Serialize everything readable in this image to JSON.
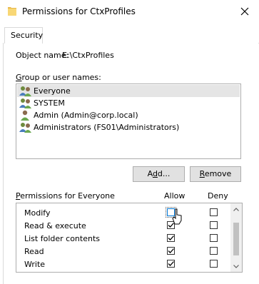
{
  "window": {
    "title": "Permissions for CtxProfiles",
    "close_glyph": "✕"
  },
  "tabs": [
    {
      "label": "Security",
      "active": true
    }
  ],
  "object": {
    "label": "Object name:",
    "value": "E:\\CtxProfiles"
  },
  "groups": {
    "label_underlined": "G",
    "label_rest": "roup or user names:",
    "items": [
      {
        "label": "Everyone",
        "icon": "group-icon",
        "selected": true
      },
      {
        "label": "SYSTEM",
        "icon": "group-icon",
        "selected": false
      },
      {
        "label": "Admin (Admin@corp.local)",
        "icon": "user-icon",
        "selected": false
      },
      {
        "label": "Administrators (FS01\\Administrators)",
        "icon": "group-icon",
        "selected": false
      }
    ]
  },
  "buttons": {
    "add_pre": "A",
    "add_underlined": "d",
    "add_post": "d...",
    "remove_underlined": "R",
    "remove_post": "emove"
  },
  "permissions": {
    "label_underlined": "P",
    "label_rest": "ermissions for Everyone",
    "allow_header": "Allow",
    "deny_header": "Deny",
    "rows": [
      {
        "label": "Modify",
        "allow": false,
        "deny": false,
        "focused": true
      },
      {
        "label": "Read & execute",
        "allow": true,
        "deny": false
      },
      {
        "label": "List folder contents",
        "allow": true,
        "deny": false
      },
      {
        "label": "Read",
        "allow": true,
        "deny": false
      },
      {
        "label": "Write",
        "allow": true,
        "deny": false
      }
    ]
  },
  "colors": {
    "selection": "#e5e5e5",
    "button_face": "#e1e1e1",
    "border": "#adadad",
    "focus": "#0078d7"
  }
}
